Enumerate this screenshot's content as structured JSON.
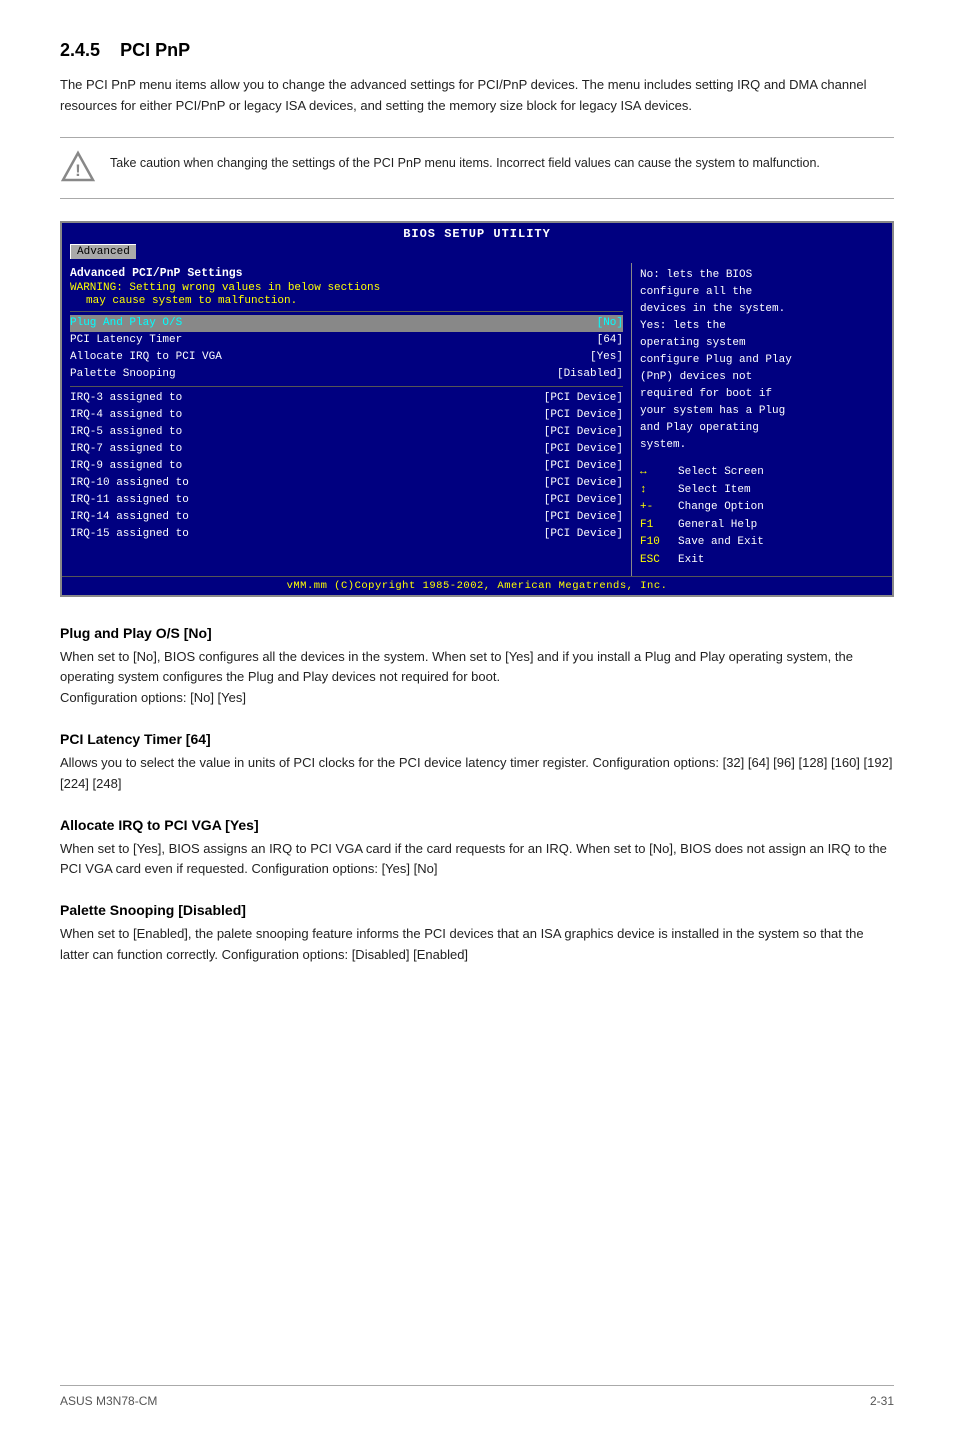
{
  "header": {
    "section_num": "2.4.5",
    "section_title": "PCI PnP"
  },
  "intro": {
    "text": "The PCI PnP menu items allow you to change the advanced settings for PCI/PnP devices. The menu includes setting IRQ and DMA channel resources for either PCI/PnP or legacy ISA devices, and setting the memory size block for legacy ISA devices."
  },
  "warning": {
    "text": "Take caution when changing the settings of the PCI PnP menu items. Incorrect field values can cause the system to malfunction."
  },
  "bios": {
    "title": "BIOS SETUP UTILITY",
    "tab": "Advanced",
    "section_title": "Advanced PCI/PnP Settings",
    "warning_line1": "WARNING: Setting wrong values in below sections",
    "warning_line2": "may cause system to malfunction.",
    "rows": [
      {
        "label": "Plug And Play O/S",
        "value": "[No]",
        "highlighted": true
      },
      {
        "label": "PCI Latency Timer",
        "value": "[64]",
        "highlighted": false
      },
      {
        "label": "Allocate IRQ to PCI VGA",
        "value": "[Yes]",
        "highlighted": false
      },
      {
        "label": "Palette Snooping",
        "value": "[Disabled]",
        "highlighted": false
      }
    ],
    "irq_rows": [
      {
        "label": "IRQ-3  assigned to",
        "value": "[PCI Device]"
      },
      {
        "label": "IRQ-4  assigned to",
        "value": "[PCI Device]"
      },
      {
        "label": "IRQ-5  assigned to",
        "value": "[PCI Device]"
      },
      {
        "label": "IRQ-7  assigned to",
        "value": "[PCI Device]"
      },
      {
        "label": "IRQ-9  assigned to",
        "value": "[PCI Device]"
      },
      {
        "label": "IRQ-10 assigned to",
        "value": "[PCI Device]"
      },
      {
        "label": "IRQ-11 assigned to",
        "value": "[PCI Device]"
      },
      {
        "label": "IRQ-14 assigned to",
        "value": "[PCI Device]"
      },
      {
        "label": "IRQ-15 assigned to",
        "value": "[PCI Device]"
      }
    ],
    "help_text": [
      "No: lets the BIOS",
      "configure all the",
      "devices in the system.",
      "Yes: lets the",
      "operating system",
      "configure Plug and Play",
      "(PnP) devices not",
      "required for boot if",
      "your system has a Plug",
      "and Play operating",
      "system."
    ],
    "nav": [
      {
        "key": "↔",
        "label": "Select Screen"
      },
      {
        "key": "↕",
        "label": "Select Item"
      },
      {
        "key": "+-",
        "label": "Change Option"
      },
      {
        "key": "F1",
        "label": "General Help"
      },
      {
        "key": "F10",
        "label": "Save and Exit"
      },
      {
        "key": "ESC",
        "label": "Exit"
      }
    ],
    "footer": "vMM.mm (C)Copyright 1985-2002, American Megatrends, Inc."
  },
  "subsections": [
    {
      "id": "plug-play",
      "title": "Plug and Play O/S [No]",
      "body": "When set to [No], BIOS configures all the devices in the system. When set to [Yes] and if you install a Plug and Play operating system, the operating system configures the Plug and Play devices not required for boot.\nConfiguration options: [No] [Yes]"
    },
    {
      "id": "pci-latency",
      "title": "PCI Latency Timer [64]",
      "body": "Allows you to select the value in units of PCI clocks for the PCI device latency timer register. Configuration options: [32] [64] [96] [128] [160] [192] [224] [248]"
    },
    {
      "id": "allocate-irq",
      "title": "Allocate IRQ to PCI VGA [Yes]",
      "body": "When set to [Yes], BIOS assigns an IRQ to PCI VGA card if the card requests for an IRQ. When set to [No], BIOS does not assign an IRQ to the PCI VGA card even if requested. Configuration options: [Yes] [No]"
    },
    {
      "id": "palette-snooping",
      "title": "Palette Snooping [Disabled]",
      "body": "When set to [Enabled], the palete snooping feature informs the PCI devices that an ISA graphics device is installed in the system so that the latter can function correctly. Configuration options: [Disabled] [Enabled]"
    }
  ],
  "footer": {
    "left": "ASUS M3N78-CM",
    "right": "2-31"
  }
}
